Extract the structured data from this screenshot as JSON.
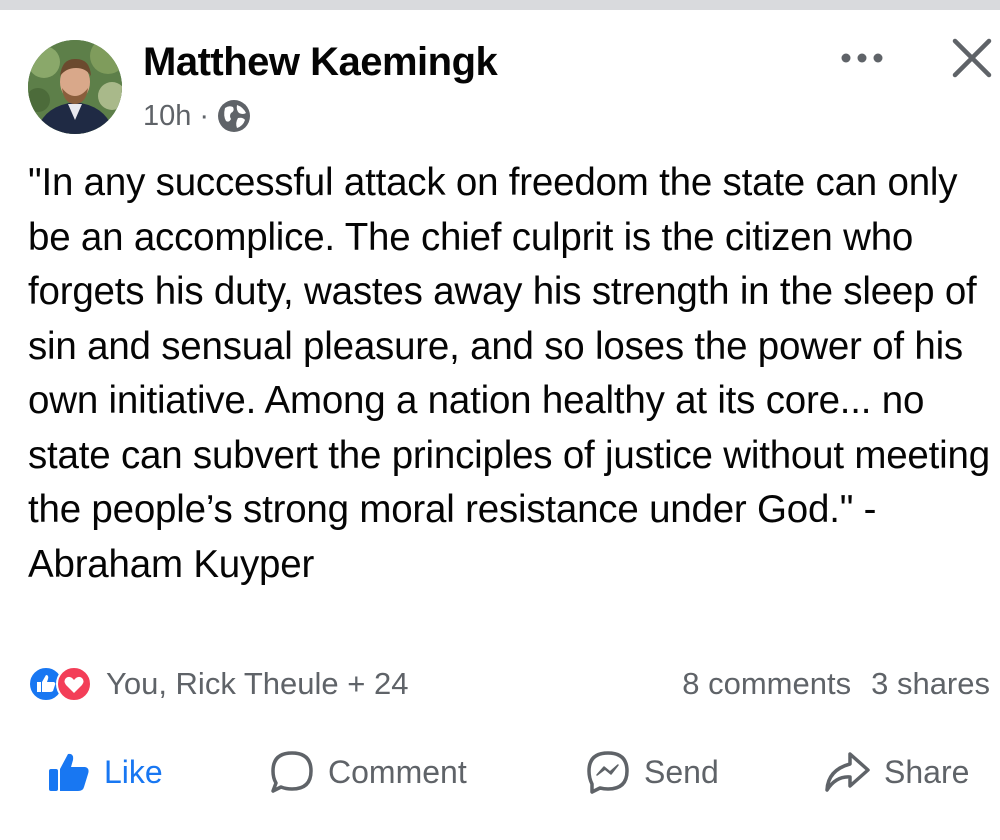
{
  "post": {
    "author": "Matthew Kaemingk",
    "time": "10h",
    "separator": "·",
    "audience_icon": "globe-icon",
    "more_icon": "ellipsis-icon",
    "close_icon": "close-icon",
    "text": "\"In any successful attack on freedom the state can only be an accomplice. The chief culprit is the citizen who forgets his duty, wastes away his strength in the sleep of sin and sensual pleasure, and so loses the power of his own initiative. Among a nation healthy at its core... no state can subvert the principles of justice without meeting the people’s strong moral resistance under God.\" - Abraham Kuyper"
  },
  "engagement": {
    "reactors": "You, Rick Theule + 24",
    "comments": "8 comments",
    "shares": "3 shares"
  },
  "actions": {
    "like": "Like",
    "comment": "Comment",
    "send": "Send",
    "share": "Share"
  },
  "colors": {
    "like_blue": "#1877f2",
    "love_red": "#f33e58",
    "secondary_text": "#5f6368"
  }
}
